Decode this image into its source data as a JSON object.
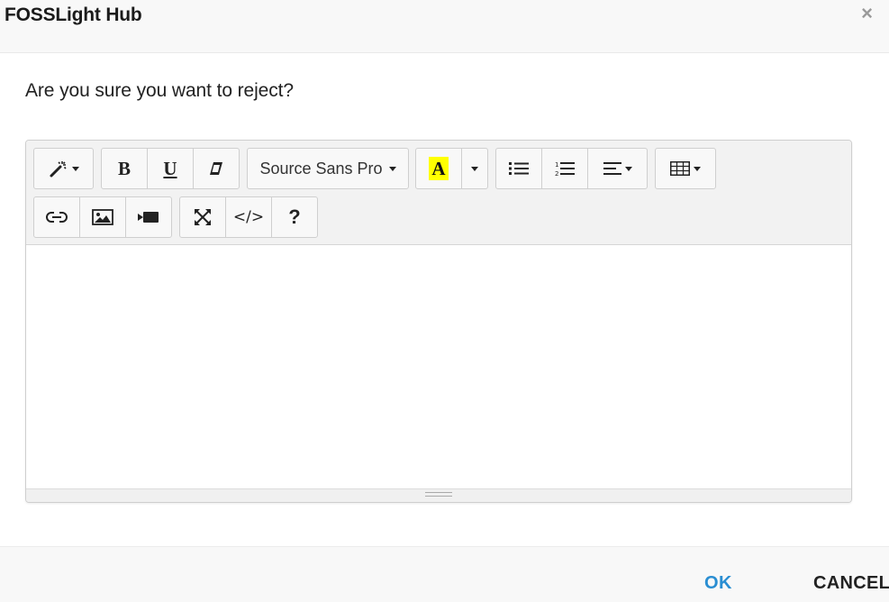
{
  "dialog": {
    "title": "FOSSLight Hub",
    "close_glyph": "×",
    "message": "Are you sure you want to reject?"
  },
  "toolbar": {
    "style_icon": "magic-wand-icon",
    "bold_label": "B",
    "underline_label": "U",
    "clear_icon": "eraser-icon",
    "font_name": "Source Sans Pro",
    "color_label": "A",
    "highlight_color": "#ffff00",
    "bulleted_list_icon": "bulleted-list-icon",
    "numbered_list_icon": "numbered-list-icon",
    "align_icon": "align-left-icon",
    "table_icon": "table-icon",
    "link_icon": "link-icon",
    "image_icon": "image-icon",
    "video_icon": "video-icon",
    "fullscreen_icon": "fullscreen-icon",
    "code_view_label": "</>",
    "help_label": "?"
  },
  "editor": {
    "content": ""
  },
  "footer": {
    "ok_label": "OK",
    "cancel_label": "CANCEL"
  },
  "colors": {
    "ok_accent": "#2a8ed2",
    "header_bg": "#f8f8f8",
    "toolbar_bg": "#f2f2f2"
  }
}
